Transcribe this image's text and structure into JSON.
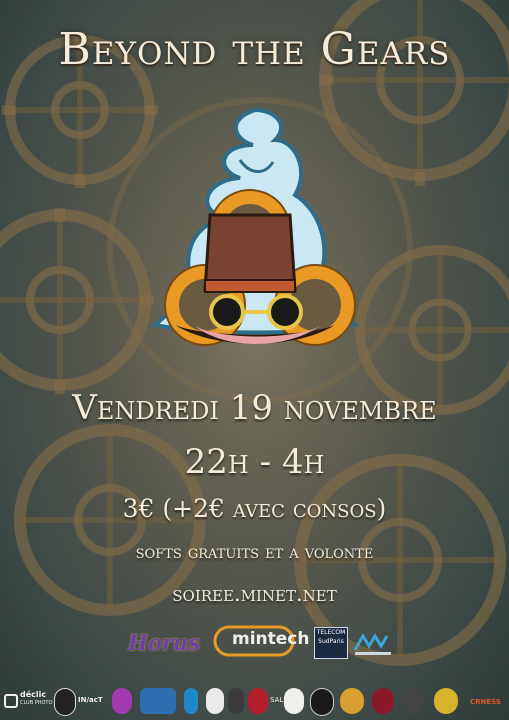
{
  "title": "Beyond the Gears",
  "event": {
    "date": "Vendredi 19 novembre",
    "hours": "22h - 4h",
    "price": "3€ (+2€ avec consos)",
    "softs": "softs gratuits et a volonte",
    "website": "soiree.minet.net"
  },
  "sponsors": {
    "horus": "Horus",
    "mintech": "mintech",
    "telecom_line1": "TELECOM",
    "telecom_line2": "SudParis"
  },
  "associations": {
    "declic": "déclic",
    "declic_sub": "CLUB PHOTO",
    "impact": "IN/acT",
    "salsa": "SALSA",
    "crness": "CRNESS"
  },
  "colors": {
    "title": "#f4ecd8",
    "gear_orange": "#e89a25",
    "hat_brown": "#7a4230",
    "flame_blue": "#c9e8f3"
  }
}
